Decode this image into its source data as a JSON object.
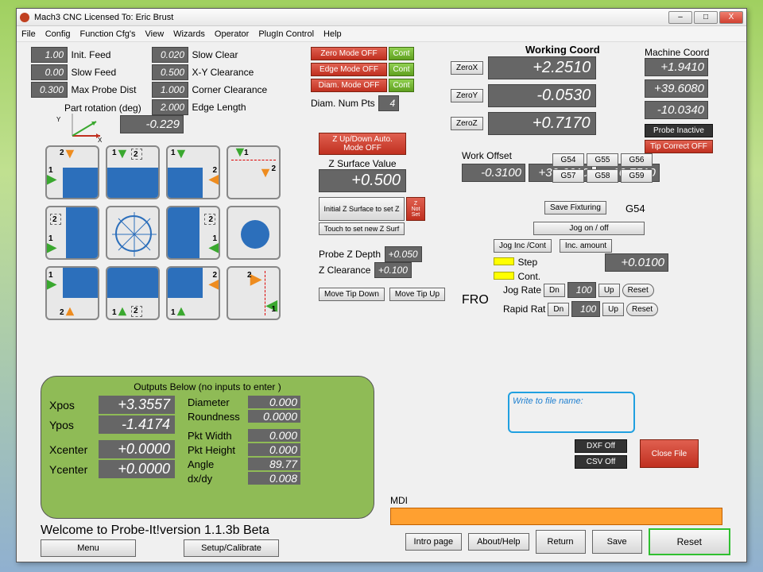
{
  "window": {
    "title": "Mach3 CNC  Licensed To: Eric Brust",
    "minimize": "–",
    "maximize": "□",
    "close": "X"
  },
  "menu": [
    "File",
    "Config",
    "Function Cfg's",
    "View",
    "Wizards",
    "Operator",
    "PlugIn Control",
    "Help"
  ],
  "feeds": {
    "init_feed_label": "Init. Feed",
    "init_feed": "1.00",
    "slow_feed_label": "Slow Feed",
    "slow_feed": "0.00",
    "max_probe_label": "Max Probe Dist",
    "max_probe": "0.300",
    "part_rot_label": "Part rotation (deg)",
    "part_rot": "-0.229"
  },
  "clearances": {
    "slow_clear_label": "Slow Clear",
    "slow_clear": "0.020",
    "xy_label": "X-Y Clearance",
    "xy": "0.500",
    "corner_label": "Corner Clearance",
    "corner": "1.000",
    "edge_label": "Edge Length",
    "edge": "2.000"
  },
  "modes": {
    "zero": "Zero Mode OFF",
    "zero_cont": "Cont",
    "edge": "Edge Mode OFF",
    "edge_cont": "Cont",
    "diam": "Diam. Mode OFF",
    "diam_cont": "Cont",
    "diam_pts_label": "Diam. Num Pts",
    "diam_pts": "4",
    "z_auto": "Z Up/Down Auto. Mode OFF",
    "z_surf_label": "Z Surface Value",
    "z_surf": "+0.500",
    "init_z": "Initial Z Surface to set Z",
    "touch_z": "Touch to set new Z Surf",
    "z_not_set": "Z Not Set",
    "probe_z_label": "Probe Z Depth",
    "probe_z": "+0.050",
    "z_clear_label": "Z Clearance",
    "z_clear": "+0.100",
    "tip_down": "Move Tip Down",
    "tip_up": "Move Tip Up"
  },
  "coords": {
    "working_hdr": "Working Coord",
    "zerox": "ZeroX",
    "x": "+2.2510",
    "zeroy": "ZeroY",
    "y": "-0.0530",
    "zeroz": "ZeroZ",
    "z": "+0.7170",
    "machine_hdr": "Machine Coord",
    "mx": "+1.9410",
    "my": "+39.6080",
    "mz": "-10.0340",
    "probe_inactive": "Probe Inactive",
    "tip_correct": "Tip Correct OFF"
  },
  "offsets": {
    "label": "Work Offset",
    "a": "-0.3100",
    "b": "+39.6610",
    "c": "-10.7510",
    "g": [
      "G54",
      "G55",
      "G56",
      "G57",
      "G58",
      "G59"
    ],
    "save": "Save Fixturing",
    "active": "G54"
  },
  "jog": {
    "onoff": "Jog on / off",
    "inc_cont": "Jog Inc /Cont",
    "inc_amt": "Inc. amount",
    "inc_val": "+0.0100",
    "step": "Step",
    "cont": "Cont.",
    "fro": "FRO",
    "jog_rate": "Jog Rate",
    "rapid_rate": "Rapid Rat",
    "dn": "Dn",
    "up": "Up",
    "val": "100",
    "reset": "Reset"
  },
  "outputs": {
    "hdr": "Outputs Below (no inputs to enter )",
    "xpos_l": "Xpos",
    "xpos": "+3.3557",
    "ypos_l": "Ypos",
    "ypos": "-1.4174",
    "xc_l": "Xcenter",
    "xc": "+0.0000",
    "yc_l": "Ycenter",
    "yc": "+0.0000",
    "diam_l": "Diameter",
    "diam": "0.000",
    "round_l": "Roundness",
    "round": "0.0000",
    "pw_l": "Pkt Width",
    "pw": "0.000",
    "ph_l": "Pkt Height",
    "ph": "0.000",
    "ang_l": "Angle",
    "ang": "89.77",
    "dxdy_l": "dx/dy",
    "dxdy": "0.008"
  },
  "file": {
    "prompt": "Write to file name:",
    "dxf": "DXF Off",
    "csv": "CSV Off",
    "close": "Close File"
  },
  "mdi": {
    "label": "MDI"
  },
  "footer": {
    "welcome": "Welcome to Probe-It!version 1.1.3b Beta",
    "menu": "Menu",
    "setup": "Setup/Calibrate",
    "intro": "Intro page",
    "about": "About/Help",
    "return": "Return",
    "save": "Save",
    "reset": "Reset"
  }
}
